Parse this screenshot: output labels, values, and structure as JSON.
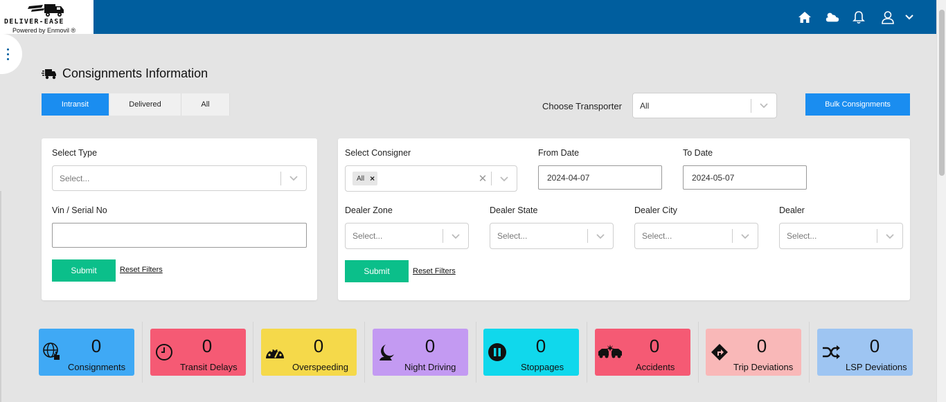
{
  "header": {
    "logo_title": "DELIVER-EASE",
    "logo_sub": "Powered by Enmovil ®",
    "icons": [
      "home-icon",
      "weather-icon",
      "bell-icon",
      "user-icon",
      "chevron-down-icon"
    ],
    "bg_color": "#005e9e"
  },
  "page": {
    "title": "Consignments Information"
  },
  "tabs": [
    {
      "label": "Intransit",
      "active": true
    },
    {
      "label": "Delivered",
      "active": false
    },
    {
      "label": "All",
      "active": false
    }
  ],
  "transporter": {
    "label": "Choose Transporter",
    "value": "All"
  },
  "bulk_button": "Bulk Consignments",
  "filter_left": {
    "type_label": "Select Type",
    "type_placeholder": "Select...",
    "vin_label": "Vin / Serial No",
    "vin_value": "",
    "submit": "Submit",
    "reset": "Reset Filters"
  },
  "filter_right": {
    "consigner_label": "Select Consigner",
    "consigner_chip": "All",
    "from_label": "From Date",
    "from_value": "2024-04-07",
    "to_label": "To Date",
    "to_value": "2024-05-07",
    "zone_label": "Dealer Zone",
    "state_label": "Dealer State",
    "city_label": "Dealer City",
    "dealer_label": "Dealer",
    "placeholder": "Select...",
    "submit": "Submit",
    "reset": "Reset Filters"
  },
  "stats": [
    {
      "name": "Consignments",
      "value": "0",
      "color": "#3fa9f5",
      "icon": "globe-hand-icon"
    },
    {
      "name": "Transit Delays",
      "value": "0",
      "color": "#f55a74",
      "icon": "clock-icon"
    },
    {
      "name": "Overspeeding",
      "value": "0",
      "color": "#f5d94a",
      "icon": "speedometer-icon"
    },
    {
      "name": "Night Driving",
      "value": "0",
      "color": "#c39af2",
      "icon": "moon-icon"
    },
    {
      "name": "Stoppages",
      "value": "0",
      "color": "#10d8ec",
      "icon": "pause-icon"
    },
    {
      "name": "Accidents",
      "value": "0",
      "color": "#f55a74",
      "icon": "crash-icon"
    },
    {
      "name": "Trip Deviations",
      "value": "0",
      "color": "#f9b8b8",
      "icon": "route-sign-icon"
    },
    {
      "name": "LSP Deviations",
      "value": "0",
      "color": "#9ec5f2",
      "icon": "shuffle-icon"
    }
  ]
}
